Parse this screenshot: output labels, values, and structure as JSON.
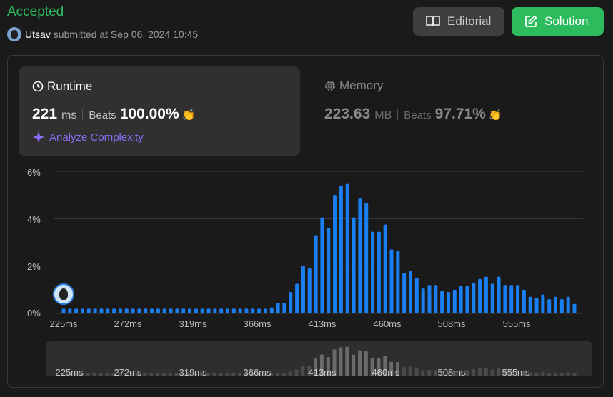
{
  "header": {
    "status": "Accepted",
    "username": "Utsav",
    "submitted_text": "submitted at Sep 06, 2024 10:45",
    "status_color": "#2cbb5d"
  },
  "actions": {
    "editorial_label": "Editorial",
    "solution_label": "Solution",
    "editorial_icon": "book-open-icon",
    "solution_icon": "edit-icon"
  },
  "runtime": {
    "title": "Runtime",
    "value": "221",
    "unit": "ms",
    "beats_label": "Beats",
    "beats_pct": "100.00%",
    "analyze_label": "Analyze Complexity",
    "icon": "clock-icon"
  },
  "memory": {
    "title": "Memory",
    "value": "223.63",
    "unit": "MB",
    "beats_label": "Beats",
    "beats_pct": "97.71%",
    "icon": "chip-icon"
  },
  "colors": {
    "bar": "#1a7ff2",
    "mini_bar": "#4a4a4a",
    "mini_bar_highlight": "#6a6a6a",
    "accent_purple": "#8b6cf6"
  },
  "chart_data": {
    "type": "bar",
    "ylabel_ticks": [
      "6%",
      "4%",
      "2%",
      "0%"
    ],
    "ylim": [
      0,
      6
    ],
    "x_tick_labels": [
      "225ms",
      "272ms",
      "319ms",
      "366ms",
      "413ms",
      "460ms",
      "508ms",
      "555ms"
    ],
    "grid": true,
    "user_marker_bar_index": 0,
    "values": [
      0.2,
      0.2,
      0.2,
      0.2,
      0.2,
      0.2,
      0.2,
      0.2,
      0.2,
      0.2,
      0.2,
      0.2,
      0.2,
      0.2,
      0.2,
      0.2,
      0.2,
      0.2,
      0.2,
      0.2,
      0.2,
      0.2,
      0.2,
      0.2,
      0.2,
      0.2,
      0.2,
      0.2,
      0.2,
      0.2,
      0.2,
      0.2,
      0.2,
      0.25,
      0.45,
      0.45,
      0.9,
      1.25,
      2.0,
      1.9,
      3.3,
      4.05,
      3.6,
      5.0,
      5.4,
      5.5,
      4.05,
      4.85,
      4.65,
      3.45,
      3.45,
      3.75,
      2.7,
      2.65,
      1.7,
      1.8,
      1.5,
      1.05,
      1.2,
      1.2,
      0.95,
      0.9,
      1.0,
      1.15,
      1.15,
      1.3,
      1.45,
      1.55,
      1.25,
      1.55,
      1.2,
      1.2,
      1.2,
      1.0,
      0.7,
      0.65,
      0.8,
      0.6,
      0.7,
      0.6,
      0.7,
      0.4
    ]
  }
}
